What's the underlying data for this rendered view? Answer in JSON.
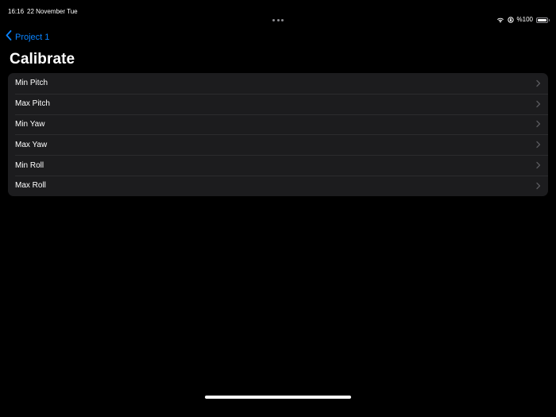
{
  "status_bar": {
    "time": "16:16",
    "date": "22 November Tue",
    "battery_text": "%100",
    "battery_level": 1.0,
    "icons": [
      "wifi-icon",
      "orientation-lock-icon",
      "battery-icon"
    ]
  },
  "nav": {
    "back_label": "Project 1",
    "back_icon": "chevron-left-icon"
  },
  "title": "Calibrate",
  "list": {
    "items": [
      {
        "label": "Min Pitch"
      },
      {
        "label": "Max Pitch"
      },
      {
        "label": "Min Yaw"
      },
      {
        "label": "Max Yaw"
      },
      {
        "label": "Min Roll"
      },
      {
        "label": "Max Roll"
      }
    ],
    "row_icon": "chevron-right-icon"
  },
  "colors": {
    "background": "#000000",
    "accent": "#0a84ff",
    "row_background": "#1c1c1e",
    "separator": "#2c2c2e",
    "chevron": "#5a5a5e"
  }
}
